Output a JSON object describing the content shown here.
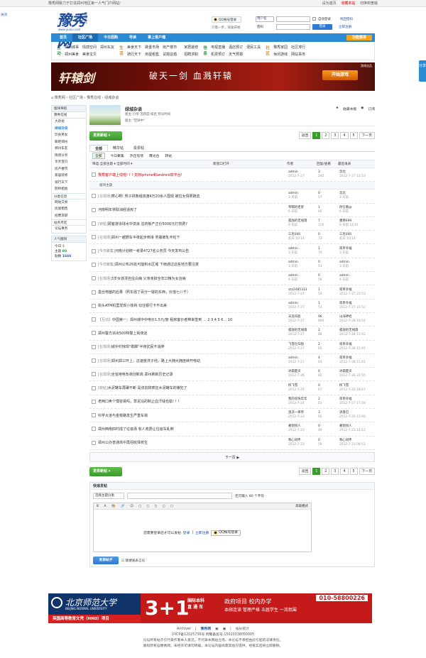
{
  "topbar": {
    "slogan": "豫秀网致力于打造郑州地区第一人气门户网站!",
    "set_home": "设为首页",
    "fav": "收藏本站",
    "switch": "切换到宽版"
  },
  "close": "关闭",
  "header": {
    "logo_text": "豫秀网",
    "logo_url": "www.yuxiu.com",
    "logo_side": "豫秀文化",
    "qq_login": "QQ帐号登录",
    "hint": "只需一步，快速开始",
    "user_select": "用户名",
    "password_label": "密码",
    "auto_login": "自动登录",
    "find_pwd": "找回密码",
    "login_btn": "登录",
    "register": "立即注册"
  },
  "nav": {
    "items": [
      "首页",
      "社区广场",
      "今日团购",
      "导读",
      "掌上客户端"
    ],
    "active": 1,
    "func_menu": "功能菜单"
  },
  "cats": [
    {
      "label": "互动",
      "color": "green",
      "items": [
        "郑州城事",
        "情感空间",
        "郑州车友",
        "郑州美食",
        "美食宝贝"
      ]
    },
    {
      "label": "生活",
      "color": "orange",
      "items": [
        "美食天下",
        "跳蚤市场",
        "房产楼市",
        "骑行天下",
        "房屋租售",
        "试婚征婚"
      ]
    },
    {
      "label": "",
      "color": "orange",
      "items": [
        "家居装修",
        "招聘求职"
      ]
    },
    {
      "label": "信息",
      "color": "green",
      "items": [
        "电视直播",
        "酒店预订",
        "便民工具",
        "机票预订",
        "天气预报"
      ]
    },
    {
      "label": "社区",
      "color": "orange",
      "items": [
        "豫秀家园",
        "社区排行",
        "休闲游戏",
        "网站事务"
      ]
    }
  ],
  "banner": {
    "title": "轩辕剑",
    "subtitle": "破天一剑 血溅轩辕",
    "play_btn": "开始游戏",
    "tag": "游戏出品"
  },
  "breadcrumb": "豫秀网 › 社区广场 › 豫秀在线 › 绿城杂谈",
  "sidebar": {
    "nav_title": "版块导航",
    "group1": "豫秀在线",
    "group1_items": [
      "大杂烩",
      "绿城杂谈",
      "饮食男女",
      "聊吧郑州",
      "郑州车友",
      "情感分享",
      "亲亲宝贝",
      "房产楼市",
      "家居装修",
      "骑行天下",
      "鹊桥相会"
    ],
    "group2": "分类信息",
    "group2_items": [
      "网站交易",
      "房屋租售",
      "招聘求职"
    ],
    "group3": "站务专区",
    "group3_items": [
      "论坛事务"
    ],
    "stats_title": "人气版块",
    "stats": {
      "today_label": "今日",
      "today": "3",
      "topics_label": "主题",
      "topics": "80",
      "posts_label": "贴数",
      "posts": "1666"
    }
  },
  "forum": {
    "name": "绿城杂谈",
    "meta": "版主:小绿  活跃度:排名  积分时间",
    "moderator": "版主:\"空缺中\"",
    "fav": "收藏本版",
    "rss": "订阅"
  },
  "toolbar": {
    "new_post": "发表新帖",
    "pages": [
      "返回",
      "1",
      "2",
      "3",
      "4",
      "5",
      "下一页"
    ],
    "current_page": "1"
  },
  "tabs": [
    "全部",
    "精华帖",
    "投票帖"
  ],
  "subfilter": [
    "全部",
    "今日聚集",
    "热在现场",
    "曝光台",
    "转帖"
  ],
  "thead": {
    "filter": "筛选:全部主题 ▾ 全部时间 ▾",
    "new_window": "新窗口打开",
    "author": "作者",
    "replies": "回复/查看",
    "last": "最后发表"
  },
  "top_post": {
    "title": "豫秀客户端上线啦! ! ! 支持iphone和android双平台!",
    "author": "admin",
    "date": "2012-7-27",
    "replies": "3",
    "views": "292",
    "lastuser": "念北",
    "lastdate": "2012-7-27 12:53"
  },
  "section_label": "版块主题",
  "posts": [
    {
      "cat": "[在现场]",
      "title": "寒心啊! 男子拼救组孩渡4万20余人围观 被拉女情照跑去",
      "author": "admin",
      "date": "3 天前",
      "replies": "0",
      "views": "57",
      "lastuser": "念北",
      "lastdate": "3 天前"
    },
    {
      "cat": "",
      "title": "河南明年将取消经适房了",
      "author": "草帽的拒星",
      "date": "6 天前",
      "replies": "1",
      "views": "66",
      "lastuser": "你在看@",
      "lastdate": "6 天前"
    },
    {
      "cat": "[转帖]",
      "title": "顾客游泳球水中流浪 泊药板产正价5000元打捞费?",
      "author": "孤独的无线雨",
      "date": "6 天前",
      "replies": "7",
      "views": "120",
      "lastuser": "墨寒699",
      "lastdate": "6 天前 14:01"
    },
    {
      "cat": "[在现场]",
      "title": "郑州一越野车半夜起步倒滑 男童被轧丰轮下",
      "author": "三毛000",
      "date": "前天 10:14",
      "replies": "0",
      "views": "72",
      "lastuser": "三毛000",
      "lastdate": "前天 10:14"
    },
    {
      "cat": "[今日聚集]",
      "title": "河南计划统一考录4727名公务员 今天发布公告",
      "author": "admin",
      "date": "3 天前",
      "replies": "1",
      "views": "70",
      "lastuser": "简单幸福",
      "lastdate": "3 天前"
    },
    {
      "cat": "[今日聚集]",
      "title": "郑州公布26处可能积水区域 下雨通过这些地方要注意",
      "author": "admin",
      "date": "3 天前",
      "replies": "0",
      "views": "53",
      "lastuser": "admin",
      "lastdate": "3 天前"
    },
    {
      "cat": "[在现场]",
      "title": "3岁女孩漂自虫白病 父亲亲掉全年口粮为女治病",
      "author": "admin",
      "date": "4 天前",
      "replies": "0",
      "views": "56",
      "lastuser": "admin",
      "lastdate": "4 天前"
    },
    {
      "cat": "",
      "title": "墨丝电脑的后果（照东强了百分一疑的东西，价值七八千）",
      "author": "zzz2485313",
      "date": "2012-7-27",
      "replies": "1",
      "views": "50",
      "lastuser": "简单幸福",
      "lastdate": "2012-7-27 21:53"
    },
    {
      "cat": "",
      "title": "街头ATM机里发现小铁钩 勾住银行卡不出来",
      "author": "admin",
      "date": "2012-7-27",
      "replies": "1",
      "views": "53",
      "lastuser": "简单幸福",
      "lastdate": "2012-7-27 21:52"
    },
    {
      "cat": "【互动】",
      "title": "中国第一：郑州城中中电价1.5元/度 租房客价者带来签到 ... 2 3 4 5 6 .. 10",
      "author": "天涯归客",
      "date": "2012-7-27",
      "replies": "96",
      "views": "890",
      "lastuser": "山海神经",
      "lastdate": "2012-7-28 16:54"
    },
    {
      "cat": "",
      "title": "郑州警方派出500特警上街夜巡",
      "author": "孤独的无线雨",
      "date": "2012-7-27",
      "replies": "2",
      "views": "88",
      "lastuser": "孤独的无线雨",
      "lastdate": "2012-7-28 15:42"
    },
    {
      "cat": "[在现场]",
      "title": "城中村惊现\"歇脚\"半夜扰民不消停",
      "author": "飞雪在归隐",
      "date": "2012-7-27",
      "replies": "2",
      "views": "65",
      "lastuser": "简单幸福",
      "lastdate": "2012-7-28 15:41"
    },
    {
      "cat": "[在现场]",
      "title": "郑州郑三环上，这速度洪子他，路上大拥大拥连续开电动",
      "author": "admin",
      "date": "2012-7-27",
      "replies": "4",
      "views": "83",
      "lastuser": "简单幸福",
      "lastdate": "2012-7-28 15:41"
    },
    {
      "cat": "[在现场]",
      "title": "全省用电负荷创新高 郑州刷新历史记录",
      "author": "冰霜夏天",
      "date": "2012-7-26",
      "replies": "0",
      "views": "82",
      "lastuser": "冰霜夏天",
      "lastdate": "2012-7-26 22:55"
    },
    {
      "cat": "[转帖]",
      "title": "水泥罐车再碾不断 是该割掉疯狂水泥罐车的嫌犯了",
      "author": "挥飞雪",
      "date": "2012-7-25",
      "replies": "0",
      "views": "67",
      "lastuser": "挥飞雪",
      "lastdate": "2012-7-25 18:07"
    },
    {
      "cat": "",
      "title": "老两口卖个馍容易吗，草泥马的制止血汗钱也偷! ! !",
      "author": "我的欢快年华",
      "date": "2012-7-24",
      "replies": "2",
      "views": "83",
      "lastuser": "简单幸福",
      "lastdate": "2012-7-27 17:59"
    },
    {
      "cat": "",
      "title": "科学大道与金梭路发生严重车祸",
      "author": "温凉一律草",
      "date": "2012-7-23",
      "replies": "3",
      "views": "92",
      "lastuser": "诉香已",
      "lastdate": "2012-7-25 15:00"
    },
    {
      "cat": "",
      "title": "郑州西南四村成了垃圾场 有人收费让垃圾车乱倒",
      "author": "嘉悦悦人",
      "date": "2012-7-23",
      "replies": "0",
      "views": "48",
      "lastuser": "嘉悦悦人",
      "lastdate": "2012-7-23 12:12"
    },
    {
      "cat": "",
      "title": "郑州公办普通高中再招收择校生",
      "author": "称心同伴",
      "date": "2012-7-23",
      "replies": "0",
      "views": "59",
      "lastuser": "称心同伴",
      "lastdate": "2012-7-23 08:52"
    }
  ],
  "next_page": "下一页 ▶",
  "quick": {
    "title": "快速发帖",
    "select": "选择主题分类",
    "limit": "还可输入 80 个字符",
    "adv": "高级模式",
    "toolbar": "B A 🎨 🔗 ☺ ◻ ◻ ◻ ◻ ◻",
    "login_msg": "您需要登录后才可以发帖",
    "login": "登录",
    "sep": "|",
    "register": "立即注册",
    "qq": "QQ帐号登录",
    "submit": "发表帖子",
    "checkbox": "随便发表言论"
  },
  "ad2": {
    "school": "北京师范大学",
    "school_en": "BEIJING NORMAL UNIVERSITY",
    "bottom": "英国高等教育文凭（HND）项目",
    "big": "3+1",
    "mid1": "国际本科",
    "mid2": "直 通 车",
    "r1": "政府项目 校内办学",
    "r2": "本硕连读 管理严格 五届学生 一流氛围",
    "phone": "010-58800226"
  },
  "footer": {
    "links": [
      "Archiver",
      "豫秀网",
      "站长统计"
    ],
    "icp": "沪ICP备12025736号  网警备案号:15020338050005",
    "notice1": "论坛所有帖子仅代表作者本人意见，不代表本网站立场，本论坛不承担由此引起的法律责任。",
    "notice2": "版权所有@豫秀网，未经许可请勿转载，本论坛内容尚需其他方提供，经核实后将立即删除。"
  },
  "share": "分享"
}
